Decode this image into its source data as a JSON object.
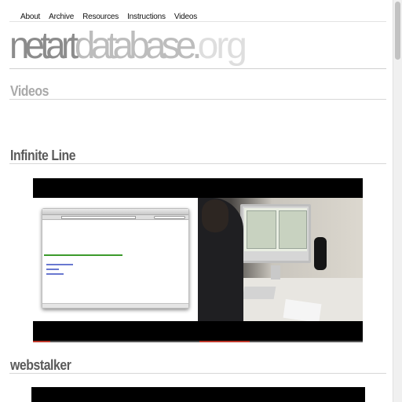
{
  "nav": {
    "items": [
      {
        "label": "About"
      },
      {
        "label": "Archive"
      },
      {
        "label": "Resources"
      },
      {
        "label": "Instructions"
      },
      {
        "label": "Videos"
      }
    ]
  },
  "logo": {
    "part1": "netart",
    "part2": "database.",
    "part3": "org"
  },
  "page": {
    "title": "Videos"
  },
  "videos": [
    {
      "title": "Infinite Line"
    },
    {
      "title": "webstalker"
    }
  ],
  "colors": {
    "progress": "#c0392b",
    "link_green": "#3c9a2c"
  }
}
